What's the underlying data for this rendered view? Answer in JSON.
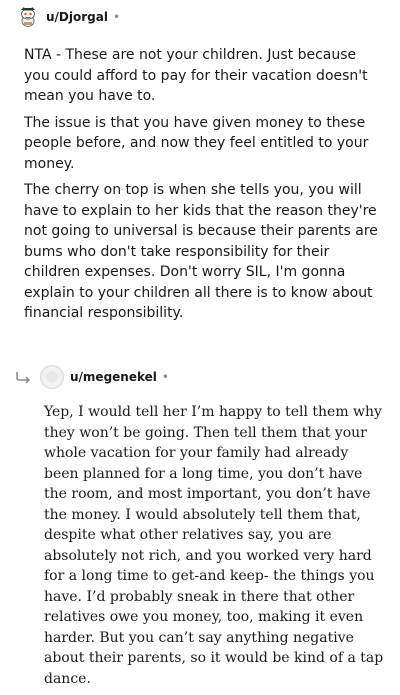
{
  "comments": [
    {
      "username": "u/Djorgal",
      "separator": "•",
      "avatar_icon": "snoo-avatar-icon",
      "paragraphs": [
        "NTA - These are not your children. Just because you could afford to pay for their vacation doesn't mean you have to.",
        "The issue is that you have given money to these people before, and now they feel entitled to your money.",
        "The cherry on top is when she tells you, you will have to explain to her kids that the reason they're not going to universal is because their parents are bums who don't take responsibility for their children expenses. Don't worry SIL, I'm gonna explain to your children all there is to know about financial responsibility."
      ]
    },
    {
      "username": "u/megenekel",
      "separator": "•",
      "avatar_icon": "default-avatar-icon",
      "reply_icon": "reply-arrow-icon",
      "paragraphs": [
        "Yep, I would tell her I’m happy to tell them why they won’t be going. Then tell them that your whole vacation for your family had already been planned for a long time, you don’t have the room, and most important, you don’t have the money. I would absolutely tell them that, despite what other relatives say, you are absolutely not rich, and you worked very hard for a long time to get-and keep- the things you have. I’d probably sneak in there that other relatives owe you money, too, making it even harder. But you can’t say anything negative about their parents, so it would be kind of a tap dance."
      ]
    }
  ]
}
